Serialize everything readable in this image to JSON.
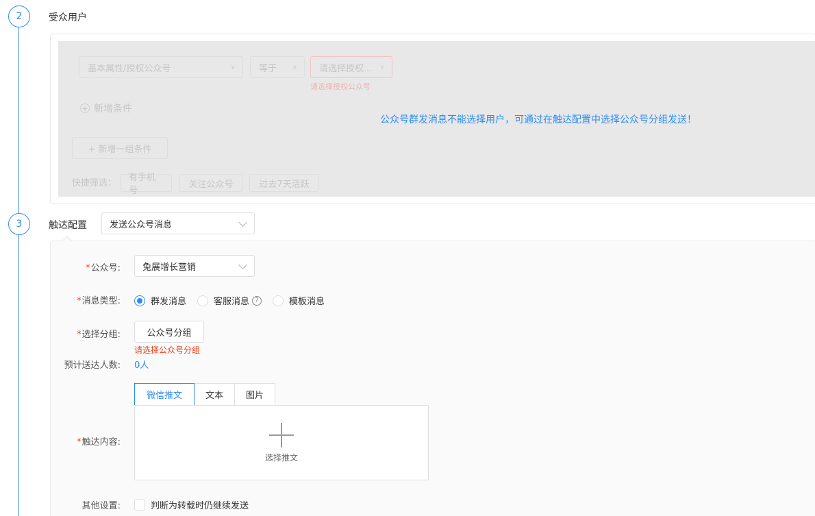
{
  "steps": [
    {
      "number": "2",
      "title": "受众用户"
    },
    {
      "number": "3",
      "title": "触达配置"
    }
  ],
  "audience": {
    "condition_field": "基本属性/授权公众号",
    "condition_operator": "等于",
    "condition_value_placeholder": "请选择授权...",
    "condition_error": "请选择授权公众号",
    "add_condition": "新增条件",
    "add_group": "+ 新增一组条件",
    "quick_filter_label": "快捷筛选：",
    "quick_filters": [
      "有手机号",
      "关注公众号",
      "过去7天活跃"
    ],
    "overlay_message": "公众号群发消息不能选择用户，可通过在触达配置中选择公众号分组发送！"
  },
  "touch": {
    "channel_select": "发送公众号消息",
    "account_label": "公众号:",
    "account_value": "兔展增长营销",
    "msg_type_label": "消息类型:",
    "msg_types": [
      "群发消息",
      "客服消息",
      "模板消息"
    ],
    "group_label": "选择分组:",
    "group_button": "公众号分组",
    "group_error": "请选择公众号分组",
    "estimate_label": "预计送达人数:",
    "estimate_value": "0人",
    "content_tabs": [
      "微信推文",
      "文本",
      "图片"
    ],
    "content_label": "触达内容:",
    "content_placeholder": "选择推文",
    "other_label": "其他设置:",
    "other_checkbox": "判断为转载时仍继续发送"
  },
  "colors": {
    "accent": "#2d8cf0",
    "error": "#ed4014"
  }
}
